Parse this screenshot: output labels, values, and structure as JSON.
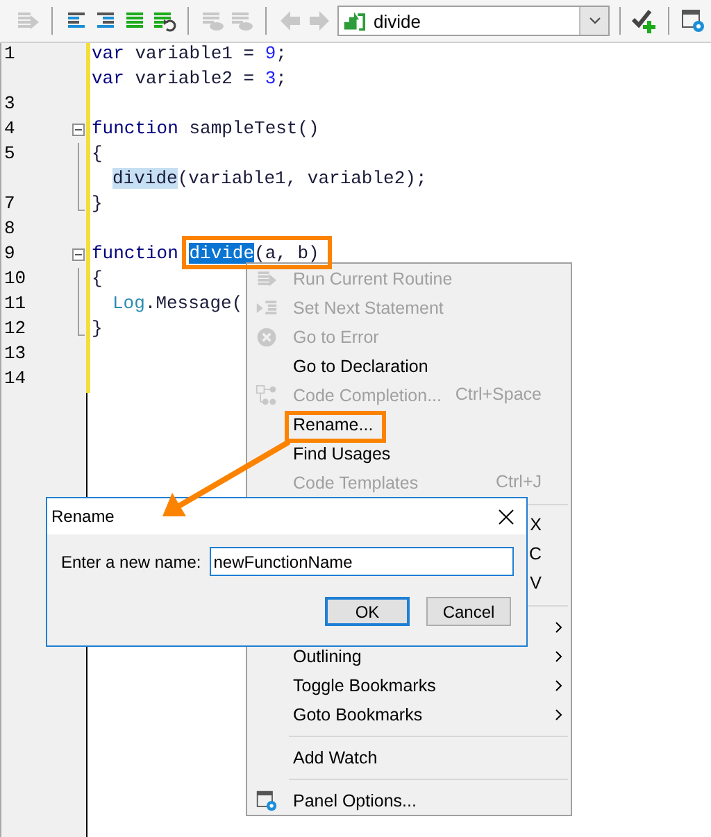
{
  "toolbar": {
    "items": [
      {
        "kind": "button",
        "disabled": true
      },
      {
        "kind": "separator"
      },
      {
        "kind": "button",
        "disabled": false
      },
      {
        "kind": "button",
        "disabled": false
      },
      {
        "kind": "button",
        "disabled": false
      },
      {
        "kind": "button",
        "disabled": false
      },
      {
        "kind": "separator"
      },
      {
        "kind": "button",
        "disabled": true
      },
      {
        "kind": "button",
        "disabled": true
      },
      {
        "kind": "separator"
      },
      {
        "kind": "button",
        "disabled": true
      },
      {
        "kind": "button",
        "disabled": true
      },
      {
        "kind": "combo",
        "value": "divide"
      },
      {
        "kind": "separator"
      },
      {
        "kind": "button",
        "disabled": false
      },
      {
        "kind": "separator"
      },
      {
        "kind": "button",
        "disabled": false
      }
    ]
  },
  "editor": {
    "lines": [
      {
        "number": "1",
        "kind": "plain",
        "tokens": [
          {
            "text": "var",
            "kind": "keyword"
          },
          {
            "text": " variable1 = ",
            "kind": "plain"
          },
          {
            "text": "9",
            "kind": "number"
          },
          {
            "text": ";",
            "kind": "plain"
          }
        ]
      },
      {
        "kind": "plain",
        "tokens": [
          {
            "text": "var",
            "kind": "keyword"
          },
          {
            "text": " variable2 = ",
            "kind": "plain"
          },
          {
            "text": "3",
            "kind": "number"
          },
          {
            "text": ";",
            "kind": "plain"
          }
        ]
      },
      {
        "number": "3",
        "kind": "plain"
      },
      {
        "number": "4",
        "kind": "fold-start",
        "tokens": [
          {
            "text": "function",
            "kind": "keyword"
          },
          {
            "text": " sampleTest()",
            "kind": "plain"
          }
        ]
      },
      {
        "number": "5",
        "kind": "fold-body",
        "tokens": [
          {
            "text": "{",
            "kind": "plain"
          }
        ]
      },
      {
        "kind": "fold-body",
        "indent": true,
        "tokens": [
          {
            "text": "divide",
            "kind": "highlight"
          },
          {
            "text": "(variable1, variable2);",
            "kind": "plain"
          }
        ]
      },
      {
        "number": "7",
        "kind": "fold-end",
        "tokens": [
          {
            "text": "}",
            "kind": "plain"
          }
        ]
      },
      {
        "number": "8",
        "kind": "plain"
      },
      {
        "number": "9",
        "kind": "fold-start",
        "tokens": [
          {
            "text": "function ",
            "kind": "keyword"
          },
          {
            "text": "divide",
            "kind": "selected"
          },
          {
            "text": "(a, b)",
            "kind": "plain"
          }
        ]
      },
      {
        "number": "10",
        "kind": "fold-body",
        "tokens": [
          {
            "text": "{",
            "kind": "plain"
          }
        ]
      },
      {
        "number": "11",
        "kind": "fold-body",
        "indent": true,
        "tokens": [
          {
            "text": "Log",
            "kind": "object"
          },
          {
            "text": ".Message(",
            "kind": "plain"
          }
        ]
      },
      {
        "number": "12",
        "kind": "fold-end",
        "tokens": [
          {
            "text": "}",
            "kind": "plain"
          }
        ]
      },
      {
        "number": "13",
        "kind": "plain"
      },
      {
        "number": "14",
        "kind": "plain"
      }
    ]
  },
  "context_menu": {
    "items": [
      {
        "kind": "item",
        "label": "Run Current Routine",
        "disabled": true
      },
      {
        "kind": "item",
        "label": "Set Next Statement",
        "disabled": true
      },
      {
        "kind": "item",
        "label": "Go to Error",
        "disabled": true
      },
      {
        "kind": "item",
        "label": "Go to Declaration",
        "disabled": false
      },
      {
        "kind": "item",
        "label": "Code Completion...",
        "shortcut": "Ctrl+Space",
        "disabled": true
      },
      {
        "kind": "item",
        "label": "Rename...",
        "disabled": false
      },
      {
        "kind": "item",
        "label": "Find Usages",
        "disabled": false
      },
      {
        "kind": "item",
        "label": "Code Templates",
        "shortcut": "Ctrl+J",
        "disabled": true
      },
      {
        "kind": "separator"
      },
      {
        "kind": "item",
        "shortcut": "X",
        "disabled": false
      },
      {
        "kind": "item",
        "shortcut": "C",
        "disabled": false
      },
      {
        "kind": "item",
        "shortcut": "V",
        "disabled": false
      },
      {
        "kind": "separator"
      },
      {
        "kind": "item",
        "submenu": true
      },
      {
        "kind": "item",
        "label": "Outlining",
        "submenu": true,
        "disabled": false
      },
      {
        "kind": "item",
        "label": "Toggle Bookmarks",
        "submenu": true,
        "disabled": false
      },
      {
        "kind": "item",
        "label": "Goto Bookmarks",
        "submenu": true,
        "disabled": false
      },
      {
        "kind": "separator"
      },
      {
        "kind": "item",
        "label": "Add Watch",
        "disabled": false
      },
      {
        "kind": "separator"
      },
      {
        "kind": "item",
        "label": "Panel Options...",
        "disabled": false
      }
    ]
  },
  "dialog": {
    "title": "Rename",
    "field_label": "Enter a new name:",
    "value": "newFunctionName",
    "buttons": [
      {
        "label": "OK",
        "default": true
      },
      {
        "label": "Cancel",
        "default": false
      }
    ]
  }
}
